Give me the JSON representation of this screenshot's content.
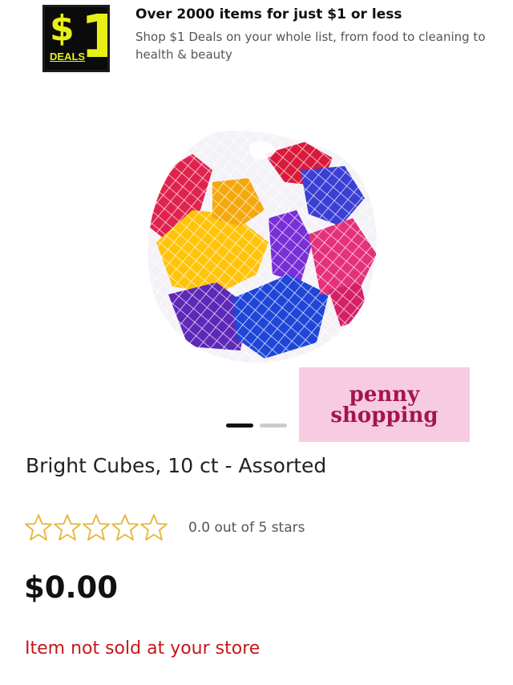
{
  "promo": {
    "logo_text_main": "$1",
    "logo_text_sub": "DEALS",
    "title": "Over 2000 items for just $1 or less",
    "description": "Shop $1 Deals on your whole list, from food to cleaning to health & beauty"
  },
  "product": {
    "image_icon": "product-photo-colorful-plastic-cubes-in-mesh-bag",
    "carousel": {
      "total_slides": 2,
      "active_index": 0
    },
    "title": "Bright Cubes, 10 ct - Assorted",
    "rating": {
      "value": 0.0,
      "max": 5,
      "text": "0.0 out of 5 stars",
      "star_color": "#e6b53a"
    },
    "price": "$0.00",
    "availability": "Item not sold at your store",
    "availability_color": "#c4171c"
  },
  "watermark": {
    "line1": "penny",
    "line2": "shopping",
    "background": "#f7cbe1",
    "color": "#a3154f"
  }
}
